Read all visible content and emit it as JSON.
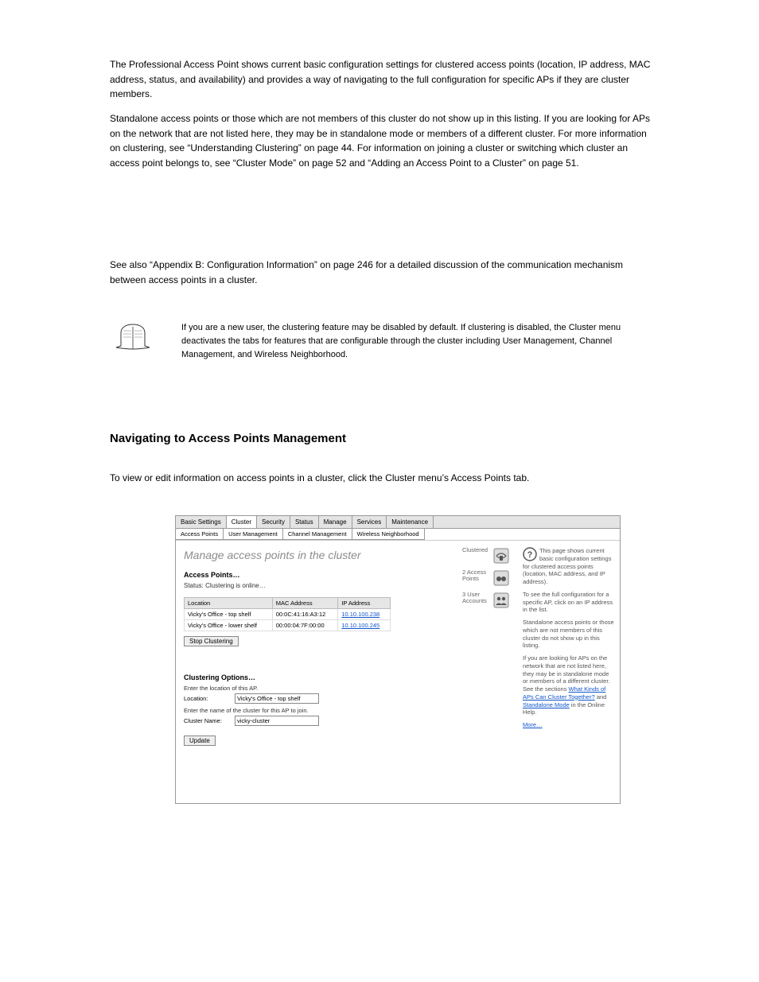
{
  "paras": {
    "p1": "The Professional Access Point shows current basic configuration settings for clustered access points (location, IP address, MAC address, status, and availability) and provides a way of navigating to the full configuration for specific APs if they are cluster members.",
    "p2": "Standalone access points or those which are not members of this cluster do not show up in this listing. If you are looking for APs on the network that are not listed here, they may be in standalone mode or members of a different cluster. For more information on clustering, see “Understanding Clustering” on page 44. For information on joining a cluster or switching which cluster an access point belongs to, see “Cluster Mode” on page 52 and “Adding an Access Point to a Cluster” on page 51.",
    "p3": "See also “Appendix B: Configuration Information” on page 246 for a detailed discussion of the communication mechanism between access points in a cluster.",
    "note": "If you are a new user, the clustering feature may be disabled by default. If clustering is disabled, the Cluster menu deactivates the tabs for features that are configurable through the cluster including User Management, Channel Management, and Wireless Neighborhood.",
    "h4": "Navigating to Access Points Management",
    "p5": "To view or edit information on access points in a cluster, click the Cluster menu’s Access Points tab."
  },
  "shot": {
    "tabs_main": [
      "Basic Settings",
      "Cluster",
      "Security",
      "Status",
      "Manage",
      "Services",
      "Maintenance"
    ],
    "tabs_sub": [
      "Access Points",
      "User Management",
      "Channel Management",
      "Wireless Neighborhood"
    ],
    "title": "Manage access points in the cluster",
    "ap_heading": "Access Points…",
    "status": "Status: Clustering is online…",
    "columns": [
      "Location",
      "MAC Address",
      "IP Address"
    ],
    "rows": [
      {
        "loc": "Vicky's Office - top shelf",
        "mac": "00:0C:41:16:A3:12",
        "ip": "10.10.100.238"
      },
      {
        "loc": "Vicky's Office - lower shelf",
        "mac": "00:00:04:7F:00:00",
        "ip": "10.10.100.245"
      }
    ],
    "stop_btn": "Stop Clustering",
    "opt_heading": "Clustering Options…",
    "loc_desc": "Enter the location of this AP.",
    "loc_label": "Location:",
    "loc_value": "Vicky's Office - top shelf",
    "name_desc": "Enter the name of the cluster for this AP to join.",
    "name_label": "Cluster Name:",
    "name_value": "vicky-cluster",
    "update_btn": "Update",
    "stats": [
      {
        "label": "Clustered"
      },
      {
        "label": "2\nAccess\nPoints"
      },
      {
        "label": "3 User\nAccounts"
      }
    ],
    "help": {
      "p1": "This page shows current basic configuration settings for clustered access points (location, MAC address, and IP address).",
      "p2": "To see the full configuration for a specific AP, click on an IP address in the list.",
      "p3": "Standalone access points or those which are not members of this cluster do not show up in this listing.",
      "p4a": "If you are looking for APs on the network that are not listed here, they may be in standalone mode or members of a different cluster. See the sections ",
      "link1": "What Kinds of APs Can Cluster Together?",
      "p4b": " and ",
      "link2": "Standalone Mode",
      "p4c": " in the Online Help.",
      "more": "More…"
    }
  }
}
